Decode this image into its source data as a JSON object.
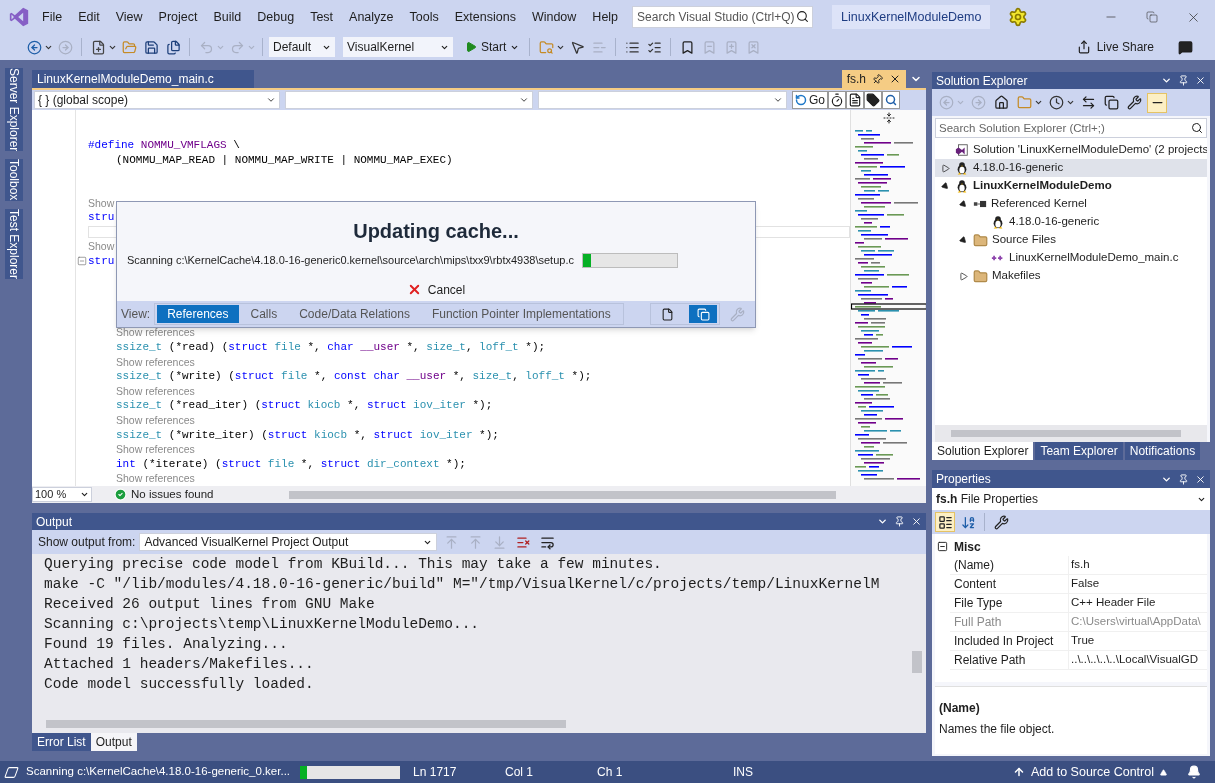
{
  "menu": {
    "items": [
      "File",
      "Edit",
      "View",
      "Project",
      "Build",
      "Debug",
      "Test",
      "Analyze",
      "Tools",
      "Extensions",
      "Window",
      "Help"
    ],
    "search": {
      "placeholder": "Search Visual Studio (Ctrl+Q)"
    },
    "solution_title": "LinuxKernelModuleDemo"
  },
  "toolbar": {
    "buttons": [
      {
        "kind": "back",
        "disabled": false
      },
      {
        "kind": "forward",
        "disabled": true
      },
      {
        "kind": "new",
        "disabled": false
      },
      {
        "kind": "open",
        "disabled": false
      },
      {
        "kind": "save",
        "disabled": false
      },
      {
        "kind": "save_all",
        "disabled": false
      },
      {
        "kind": "undo",
        "disabled": true
      },
      {
        "kind": "redo",
        "disabled": true
      }
    ],
    "configuration": "Default",
    "platform": "VisualKernel",
    "start": "Start",
    "tools": [
      {
        "kind": "find",
        "disabled": false
      },
      {
        "kind": "select",
        "disabled": false
      },
      {
        "kind": "outdent",
        "disabled": true
      },
      {
        "kind": "comment",
        "disabled": false
      },
      {
        "kind": "uncomment",
        "disabled": false
      },
      {
        "kind": "bookmark",
        "disabled": false
      },
      {
        "kind": "prev_bookmark",
        "disabled": true
      },
      {
        "kind": "next_bookmark",
        "disabled": true
      },
      {
        "kind": "clear_bookmarks",
        "disabled": true
      }
    ],
    "live_share": "Live Share"
  },
  "side_tabs": [
    "Server Explorer",
    "Toolbox",
    "Test Explorer"
  ],
  "editor": {
    "tabs": [
      {
        "label": "LinuxKernelModuleDemo_main.c",
        "kind": "document",
        "selected": false
      },
      {
        "label": "fs.h",
        "kind": "preview",
        "selected": true
      }
    ],
    "scope": "{ } (global scope)",
    "go": "Go",
    "lines": [
      {
        "kind": "code",
        "indented": false,
        "foldable": false,
        "tokens": [
          {
            "t": "#define ",
            "kind": "kw"
          },
          {
            "t": "NOMMU_VMFLAGS",
            "kind": "mac"
          },
          {
            "t": " \\",
            "kind": "txt"
          }
        ]
      },
      {
        "kind": "code",
        "indented": true,
        "foldable": false,
        "tokens": [
          {
            "t": "(NOMMU_MAP_READ | NOMMU_MAP_WRITE | NOMMU_MAP_EXEC)",
            "kind": "txt"
          }
        ]
      },
      {
        "kind": "blank"
      },
      {
        "kind": "blank"
      },
      {
        "kind": "hint",
        "indented": false,
        "text": "Show"
      },
      {
        "kind": "code",
        "indented": false,
        "foldable": false,
        "tokens": [
          {
            "t": "stru",
            "kind": "kw"
          }
        ]
      },
      {
        "kind": "caret"
      },
      {
        "kind": "hint",
        "indented": false,
        "text": "Show"
      },
      {
        "kind": "code",
        "indented": false,
        "foldable": true,
        "tokens": [
          {
            "t": "stru",
            "kind": "kw"
          }
        ]
      },
      {
        "kind": "blank"
      },
      {
        "kind": "blank"
      },
      {
        "kind": "blank"
      },
      {
        "kind": "blank"
      },
      {
        "kind": "hint",
        "indented": true,
        "text": "Show references"
      },
      {
        "kind": "code",
        "indented": true,
        "foldable": false,
        "tokens": [
          {
            "t": "ssize_t",
            "kind": "type"
          },
          {
            "t": " (*read) (",
            "kind": "txt"
          },
          {
            "t": "struct ",
            "kind": "kw"
          },
          {
            "t": "file",
            "kind": "type"
          },
          {
            "t": " *, ",
            "kind": "txt"
          },
          {
            "t": "char ",
            "kind": "kw"
          },
          {
            "t": "__user",
            "kind": "mac"
          },
          {
            "t": " *, ",
            "kind": "txt"
          },
          {
            "t": "size_t",
            "kind": "type"
          },
          {
            "t": ", ",
            "kind": "txt"
          },
          {
            "t": "loff_t",
            "kind": "type"
          },
          {
            "t": " *);",
            "kind": "txt"
          }
        ]
      },
      {
        "kind": "hint",
        "indented": true,
        "text": "Show references"
      },
      {
        "kind": "code",
        "indented": true,
        "foldable": false,
        "tokens": [
          {
            "t": "ssize_t",
            "kind": "type"
          },
          {
            "t": " (*write) (",
            "kind": "txt"
          },
          {
            "t": "struct ",
            "kind": "kw"
          },
          {
            "t": "file",
            "kind": "type"
          },
          {
            "t": " *, ",
            "kind": "txt"
          },
          {
            "t": "const char ",
            "kind": "kw"
          },
          {
            "t": "__user",
            "kind": "mac"
          },
          {
            "t": " *, ",
            "kind": "txt"
          },
          {
            "t": "size_t",
            "kind": "type"
          },
          {
            "t": ", ",
            "kind": "txt"
          },
          {
            "t": "loff_t",
            "kind": "type"
          },
          {
            "t": " *);",
            "kind": "txt"
          }
        ]
      },
      {
        "kind": "hint",
        "indented": true,
        "text": "Show references"
      },
      {
        "kind": "code",
        "indented": true,
        "foldable": false,
        "tokens": [
          {
            "t": "ssize_t",
            "kind": "type"
          },
          {
            "t": " (*read_iter) (",
            "kind": "txt"
          },
          {
            "t": "struct ",
            "kind": "kw"
          },
          {
            "t": "kiocb",
            "kind": "type"
          },
          {
            "t": " *, ",
            "kind": "txt"
          },
          {
            "t": "struct ",
            "kind": "kw"
          },
          {
            "t": "iov_iter",
            "kind": "type"
          },
          {
            "t": " *);",
            "kind": "txt"
          }
        ]
      },
      {
        "kind": "hint",
        "indented": true,
        "text": "Show references"
      },
      {
        "kind": "code",
        "indented": true,
        "foldable": false,
        "tokens": [
          {
            "t": "ssize_t",
            "kind": "type"
          },
          {
            "t": " (*write_iter) (",
            "kind": "txt"
          },
          {
            "t": "struct ",
            "kind": "kw"
          },
          {
            "t": "kiocb",
            "kind": "type"
          },
          {
            "t": " *, ",
            "kind": "txt"
          },
          {
            "t": "struct ",
            "kind": "kw"
          },
          {
            "t": "iov_iter",
            "kind": "type"
          },
          {
            "t": " *);",
            "kind": "txt"
          }
        ]
      },
      {
        "kind": "hint",
        "indented": true,
        "text": "Show references"
      },
      {
        "kind": "code",
        "indented": true,
        "foldable": false,
        "tokens": [
          {
            "t": "int",
            "kind": "kw"
          },
          {
            "t": " (*iterate) (",
            "kind": "txt"
          },
          {
            "t": "struct ",
            "kind": "kw"
          },
          {
            "t": "file",
            "kind": "type"
          },
          {
            "t": " *, ",
            "kind": "txt"
          },
          {
            "t": "struct ",
            "kind": "kw"
          },
          {
            "t": "dir_context",
            "kind": "type"
          },
          {
            "t": " *);",
            "kind": "txt"
          }
        ]
      },
      {
        "kind": "hint",
        "indented": true,
        "text": "Show references"
      }
    ],
    "zoom": "100 %",
    "issues": "No issues found"
  },
  "dialog": {
    "title": "Updating cache...",
    "status": "Scanning c:\\KernelCache\\4.18.0-16-generic0.kernel\\source\\arch\\mips\\txx9\\rbtx4938\\setup.c",
    "level": 0.09,
    "cancel": "Cancel",
    "view_label": "View:",
    "views": [
      {
        "label": "References",
        "selected": true
      },
      {
        "label": "Calls",
        "selected": false
      },
      {
        "label": "Code/Data Relations",
        "selected": false
      },
      {
        "label": "Function Pointer Implementations",
        "selected": false
      }
    ],
    "modes": [
      {
        "kind": "single",
        "selected": false
      },
      {
        "kind": "multi",
        "selected": true
      }
    ],
    "settings": {
      "disabled": true
    }
  },
  "output": {
    "title": "Output",
    "source_label": "Show output from:",
    "source": "Advanced VisualKernel Project Output",
    "tools": [
      {
        "kind": "goto",
        "disabled": true
      },
      {
        "kind": "prev",
        "disabled": true
      },
      {
        "kind": "next",
        "disabled": true
      },
      {
        "kind": "clear",
        "disabled": false
      },
      {
        "kind": "wrap",
        "disabled": false
      }
    ],
    "lines": [
      "Querying precise code model from KBuild... This may take a few minutes.",
      "make -C \"/lib/modules/4.18.0-16-generic/build\" M=\"/tmp/VisualKernel/c/projects/temp/LinuxKernelM",
      "Received 26 output lines from GNU Make",
      "Scanning c:\\projects\\temp\\LinuxKernelModuleDemo...",
      "Found 19 files. Analyzing...",
      "Attached 1 headers/Makefiles...",
      "Code model successfully loaded."
    ],
    "tabs": [
      {
        "label": "Error List",
        "selected": false
      },
      {
        "label": "Output",
        "selected": true
      }
    ]
  },
  "solution_explorer": {
    "title": "Solution Explorer",
    "tools": [
      {
        "kind": "back",
        "disabled": true,
        "selected": false
      },
      {
        "kind": "forward",
        "disabled": true,
        "selected": false
      },
      {
        "kind": "home",
        "disabled": false,
        "selected": false
      },
      {
        "kind": "views",
        "disabled": false,
        "selected": false
      },
      {
        "kind": "history",
        "disabled": false,
        "selected": false
      },
      {
        "kind": "sync",
        "disabled": false,
        "selected": false
      },
      {
        "kind": "collapse",
        "disabled": false,
        "selected": false
      },
      {
        "kind": "properties",
        "disabled": false,
        "selected": false
      },
      {
        "kind": "preview",
        "disabled": false,
        "selected": true
      }
    ],
    "search": {
      "placeholder": "Search Solution Explorer (Ctrl+;)"
    },
    "tree": [
      {
        "label": "Solution 'LinuxKernelModuleDemo' (2 projects",
        "kind": "solution",
        "selected": false,
        "startup": false
      },
      {
        "label": "4.18.0-16-generic",
        "kind": "penguin",
        "selected": true,
        "startup": false,
        "expanded": false
      },
      {
        "label": "LinuxKernelModuleDemo",
        "kind": "penguin",
        "selected": false,
        "startup": true,
        "expanded": true,
        "children": [
          {
            "label": "Referenced Kernel",
            "kind": "reference",
            "selected": false,
            "startup": false,
            "expanded": true,
            "children": [
              {
                "label": "4.18.0-16-generic",
                "kind": "penguin",
                "selected": false,
                "startup": false
              }
            ]
          },
          {
            "label": "Source Files",
            "kind": "folder",
            "selected": false,
            "startup": false,
            "expanded": true,
            "children": [
              {
                "label": "LinuxKernelModuleDemo_main.c",
                "kind": "source",
                "selected": false,
                "startup": false
              }
            ]
          },
          {
            "label": "Makefiles",
            "kind": "folder",
            "selected": false,
            "startup": false,
            "expanded": false
          }
        ]
      }
    ],
    "tabs": [
      {
        "label": "Solution Explorer",
        "selected": true
      },
      {
        "label": "Team Explorer",
        "selected": false
      },
      {
        "label": "Notifications",
        "selected": false
      }
    ]
  },
  "properties": {
    "title": "Properties",
    "object": "**fs.h** File Properties",
    "tools": [
      {
        "kind": "categorized",
        "selected": true
      },
      {
        "kind": "alphabetical",
        "selected": false
      },
      {
        "kind": "pages",
        "selected": false
      }
    ],
    "category": {
      "label": "Misc",
      "expanded": true
    },
    "rows": [
      {
        "name": "(Name)",
        "value": "fs.h",
        "disabled": false
      },
      {
        "name": "Content",
        "value": "False",
        "disabled": false
      },
      {
        "name": "File Type",
        "value": "C++ Header File",
        "disabled": false
      },
      {
        "name": "Full Path",
        "value": "C:\\Users\\virtual\\AppData\\",
        "disabled": true
      },
      {
        "name": "Included In Project",
        "value": "True",
        "disabled": false
      },
      {
        "name": "Relative Path",
        "value": "..\\..\\..\\..\\..\\Local\\VisualGD",
        "disabled": false
      }
    ],
    "description_title": "(Name)",
    "description": "Names the file object."
  },
  "status_bar": {
    "message": "Scanning c:\\KernelCache\\4.18.0-16-generic_0.ker...",
    "level": 0.07,
    "line": "Ln 1717",
    "column": "Col 1",
    "char": "Ch 1",
    "mode": "INS",
    "source_control": "Add to Source Control"
  }
}
